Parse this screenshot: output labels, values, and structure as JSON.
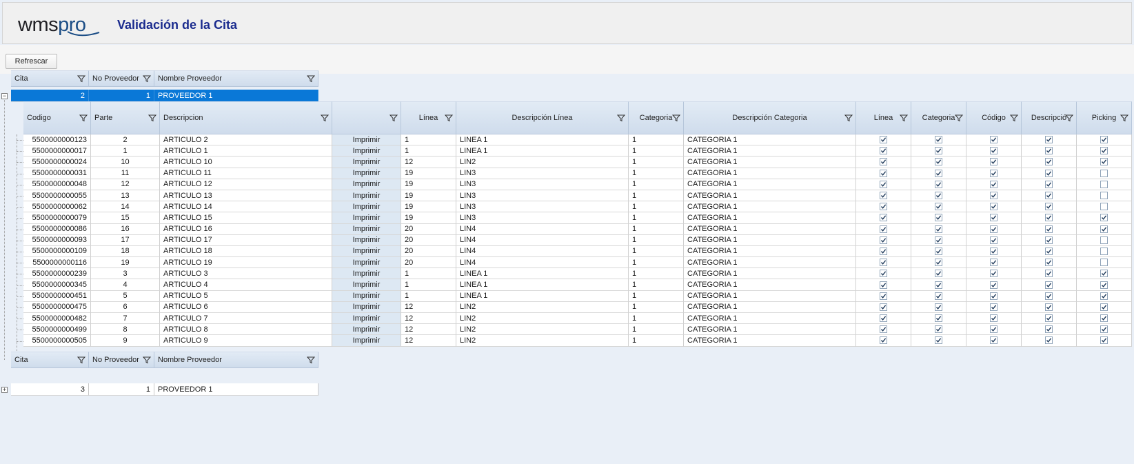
{
  "app": {
    "logo_main": "wms",
    "logo_accent": "pro",
    "title": "Validación de la Cita"
  },
  "toolbar": {
    "refresh_label": "Refrescar"
  },
  "master": {
    "columns": [
      "Cita",
      "No Proveedor",
      "Nombre Proveedor"
    ],
    "rows": [
      {
        "cita": "2",
        "no_proveedor": "1",
        "nombre_proveedor": "PROVEEDOR 1"
      },
      {
        "cita": "3",
        "no_proveedor": "1",
        "nombre_proveedor": "PROVEEDOR 1"
      }
    ]
  },
  "detail": {
    "columns": [
      "Codigo",
      "Parte",
      "Descripcion",
      "",
      "Línea",
      "Descripción Línea",
      "Categoria",
      "Descripción Categoria",
      "Línea",
      "Categoria",
      "Código",
      "Descripció",
      "Picking"
    ],
    "print_label": "Imprimir",
    "rows": [
      {
        "codigo": "5500000000123",
        "parte": "2",
        "descripcion": "ARTICULO 2",
        "linea": "1",
        "desc_linea": "LINEA 1",
        "categoria": "1",
        "desc_categoria": "CATEGORIA 1",
        "chk_linea": true,
        "chk_categoria": true,
        "chk_codigo": true,
        "chk_descripcion": true,
        "chk_picking": true
      },
      {
        "codigo": "5500000000017",
        "parte": "1",
        "descripcion": "ARTICULO 1",
        "linea": "1",
        "desc_linea": "LINEA 1",
        "categoria": "1",
        "desc_categoria": "CATEGORIA 1",
        "chk_linea": true,
        "chk_categoria": true,
        "chk_codigo": true,
        "chk_descripcion": true,
        "chk_picking": true
      },
      {
        "codigo": "5500000000024",
        "parte": "10",
        "descripcion": "ARTICULO 10",
        "linea": "12",
        "desc_linea": "LIN2",
        "categoria": "1",
        "desc_categoria": "CATEGORIA 1",
        "chk_linea": true,
        "chk_categoria": true,
        "chk_codigo": true,
        "chk_descripcion": true,
        "chk_picking": true
      },
      {
        "codigo": "5500000000031",
        "parte": "11",
        "descripcion": "ARTICULO 11",
        "linea": "19",
        "desc_linea": "LIN3",
        "categoria": "1",
        "desc_categoria": "CATEGORIA 1",
        "chk_linea": true,
        "chk_categoria": true,
        "chk_codigo": true,
        "chk_descripcion": true,
        "chk_picking": false
      },
      {
        "codigo": "5500000000048",
        "parte": "12",
        "descripcion": "ARTICULO 12",
        "linea": "19",
        "desc_linea": "LIN3",
        "categoria": "1",
        "desc_categoria": "CATEGORIA 1",
        "chk_linea": true,
        "chk_categoria": true,
        "chk_codigo": true,
        "chk_descripcion": true,
        "chk_picking": false
      },
      {
        "codigo": "5500000000055",
        "parte": "13",
        "descripcion": "ARTICULO 13",
        "linea": "19",
        "desc_linea": "LIN3",
        "categoria": "1",
        "desc_categoria": "CATEGORIA 1",
        "chk_linea": true,
        "chk_categoria": true,
        "chk_codigo": true,
        "chk_descripcion": true,
        "chk_picking": false
      },
      {
        "codigo": "5500000000062",
        "parte": "14",
        "descripcion": "ARTICULO 14",
        "linea": "19",
        "desc_linea": "LIN3",
        "categoria": "1",
        "desc_categoria": "CATEGORIA 1",
        "chk_linea": true,
        "chk_categoria": true,
        "chk_codigo": true,
        "chk_descripcion": true,
        "chk_picking": false
      },
      {
        "codigo": "5500000000079",
        "parte": "15",
        "descripcion": "ARTICULO 15",
        "linea": "19",
        "desc_linea": "LIN3",
        "categoria": "1",
        "desc_categoria": "CATEGORIA 1",
        "chk_linea": true,
        "chk_categoria": true,
        "chk_codigo": true,
        "chk_descripcion": true,
        "chk_picking": true
      },
      {
        "codigo": "5500000000086",
        "parte": "16",
        "descripcion": "ARTICULO 16",
        "linea": "20",
        "desc_linea": "LIN4",
        "categoria": "1",
        "desc_categoria": "CATEGORIA 1",
        "chk_linea": true,
        "chk_categoria": true,
        "chk_codigo": true,
        "chk_descripcion": true,
        "chk_picking": true
      },
      {
        "codigo": "5500000000093",
        "parte": "17",
        "descripcion": "ARTICULO 17",
        "linea": "20",
        "desc_linea": "LIN4",
        "categoria": "1",
        "desc_categoria": "CATEGORIA 1",
        "chk_linea": true,
        "chk_categoria": true,
        "chk_codigo": true,
        "chk_descripcion": true,
        "chk_picking": false
      },
      {
        "codigo": "5500000000109",
        "parte": "18",
        "descripcion": "ARTICULO 18",
        "linea": "20",
        "desc_linea": "LIN4",
        "categoria": "1",
        "desc_categoria": "CATEGORIA 1",
        "chk_linea": true,
        "chk_categoria": true,
        "chk_codigo": true,
        "chk_descripcion": true,
        "chk_picking": false
      },
      {
        "codigo": "5500000000116",
        "parte": "19",
        "descripcion": "ARTICULO 19",
        "linea": "20",
        "desc_linea": "LIN4",
        "categoria": "1",
        "desc_categoria": "CATEGORIA 1",
        "chk_linea": true,
        "chk_categoria": true,
        "chk_codigo": true,
        "chk_descripcion": true,
        "chk_picking": false
      },
      {
        "codigo": "5500000000239",
        "parte": "3",
        "descripcion": "ARTICULO 3",
        "linea": "1",
        "desc_linea": "LINEA 1",
        "categoria": "1",
        "desc_categoria": "CATEGORIA 1",
        "chk_linea": true,
        "chk_categoria": true,
        "chk_codigo": true,
        "chk_descripcion": true,
        "chk_picking": true
      },
      {
        "codigo": "5500000000345",
        "parte": "4",
        "descripcion": "ARTICULO 4",
        "linea": "1",
        "desc_linea": "LINEA 1",
        "categoria": "1",
        "desc_categoria": "CATEGORIA 1",
        "chk_linea": true,
        "chk_categoria": true,
        "chk_codigo": true,
        "chk_descripcion": true,
        "chk_picking": true
      },
      {
        "codigo": "5500000000451",
        "parte": "5",
        "descripcion": "ARTICULO 5",
        "linea": "1",
        "desc_linea": "LINEA 1",
        "categoria": "1",
        "desc_categoria": "CATEGORIA 1",
        "chk_linea": true,
        "chk_categoria": true,
        "chk_codigo": true,
        "chk_descripcion": true,
        "chk_picking": true
      },
      {
        "codigo": "5500000000475",
        "parte": "6",
        "descripcion": "ARTICULO 6",
        "linea": "12",
        "desc_linea": "LIN2",
        "categoria": "1",
        "desc_categoria": "CATEGORIA 1",
        "chk_linea": true,
        "chk_categoria": true,
        "chk_codigo": true,
        "chk_descripcion": true,
        "chk_picking": true
      },
      {
        "codigo": "5500000000482",
        "parte": "7",
        "descripcion": "ARTICULO 7",
        "linea": "12",
        "desc_linea": "LIN2",
        "categoria": "1",
        "desc_categoria": "CATEGORIA 1",
        "chk_linea": true,
        "chk_categoria": true,
        "chk_codigo": true,
        "chk_descripcion": true,
        "chk_picking": true
      },
      {
        "codigo": "5500000000499",
        "parte": "8",
        "descripcion": "ARTICULO 8",
        "linea": "12",
        "desc_linea": "LIN2",
        "categoria": "1",
        "desc_categoria": "CATEGORIA 1",
        "chk_linea": true,
        "chk_categoria": true,
        "chk_codigo": true,
        "chk_descripcion": true,
        "chk_picking": true
      },
      {
        "codigo": "5500000000505",
        "parte": "9",
        "descripcion": "ARTICULO 9",
        "linea": "12",
        "desc_linea": "LIN2",
        "categoria": "1",
        "desc_categoria": "CATEGORIA 1",
        "chk_linea": true,
        "chk_categoria": true,
        "chk_codigo": true,
        "chk_descripcion": true,
        "chk_picking": true
      }
    ]
  },
  "colors": {
    "title": "#1a2b8e",
    "selection": "#0a78d7",
    "header_bg": "#d6e2f0",
    "print_cell_bg": "#dde8f3"
  }
}
